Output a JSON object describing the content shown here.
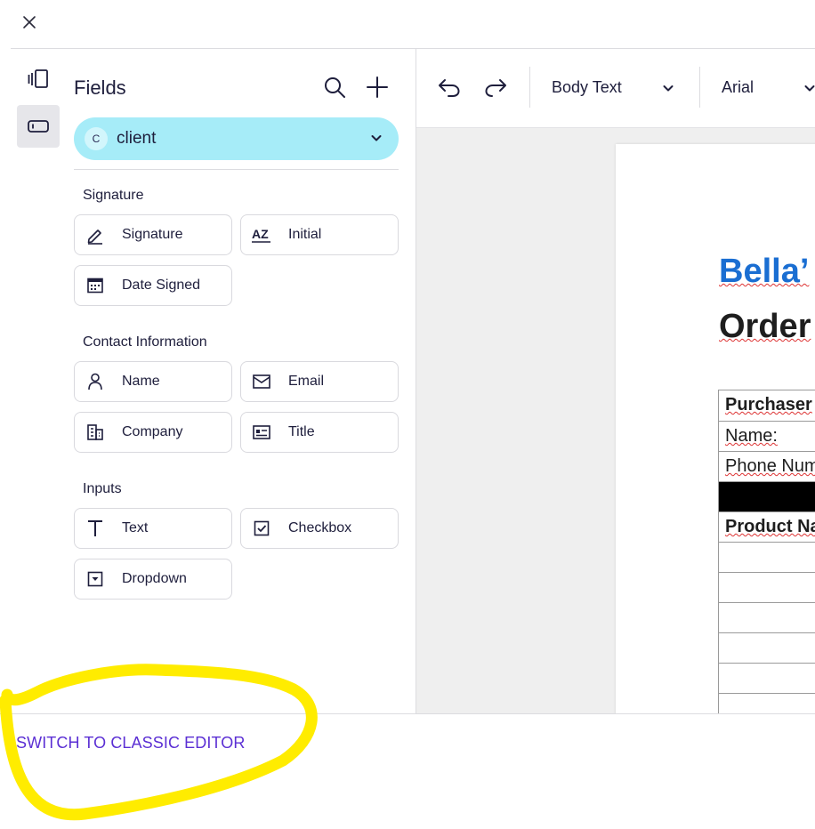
{
  "header": {
    "close_icon": "close-icon"
  },
  "rail": {
    "pages_icon": "pages-icon",
    "fields_icon": "fields-icon"
  },
  "fields_panel": {
    "title": "Fields",
    "search_icon": "search-icon",
    "add_icon": "plus-icon",
    "recipient": {
      "initial": "C",
      "name": "client",
      "accent": "#a6ecf8"
    },
    "sections": {
      "signature": {
        "title": "Signature",
        "items": [
          {
            "label": "Signature",
            "icon": "pen-icon"
          },
          {
            "label": "Initial",
            "icon": "initial-az-icon"
          },
          {
            "label": "Date Signed",
            "icon": "calendar-icon"
          }
        ]
      },
      "contact": {
        "title": "Contact Information",
        "items": [
          {
            "label": "Name",
            "icon": "person-icon"
          },
          {
            "label": "Email",
            "icon": "envelope-icon"
          },
          {
            "label": "Company",
            "icon": "building-icon"
          },
          {
            "label": "Title",
            "icon": "id-card-icon"
          }
        ]
      },
      "inputs": {
        "title": "Inputs",
        "items": [
          {
            "label": "Text",
            "icon": "text-t-icon"
          },
          {
            "label": "Checkbox",
            "icon": "checkbox-icon"
          },
          {
            "label": "Dropdown",
            "icon": "dropdown-icon"
          }
        ]
      }
    }
  },
  "toolbar": {
    "undo_icon": "undo-icon",
    "redo_icon": "redo-icon",
    "text_style": "Body Text",
    "font": "Arial"
  },
  "document": {
    "brand": "Bella’",
    "heading": "Order",
    "table_rows": [
      {
        "text": "Purchaser",
        "bold": true
      },
      {
        "text": "Name:",
        "bold": false
      },
      {
        "text": "Phone Num",
        "bold": false
      },
      {
        "text": "",
        "black": true
      },
      {
        "text": "Product Na",
        "bold": true
      },
      {
        "text": ""
      },
      {
        "text": ""
      },
      {
        "text": ""
      },
      {
        "text": ""
      },
      {
        "text": ""
      },
      {
        "text": ""
      }
    ],
    "brand_color": "#1a6ed2"
  },
  "footer": {
    "switch_label": "SWITCH TO CLASSIC EDITOR",
    "link_color": "#5b2fd4"
  },
  "annotation": {
    "highlight_color": "#ffec00"
  }
}
